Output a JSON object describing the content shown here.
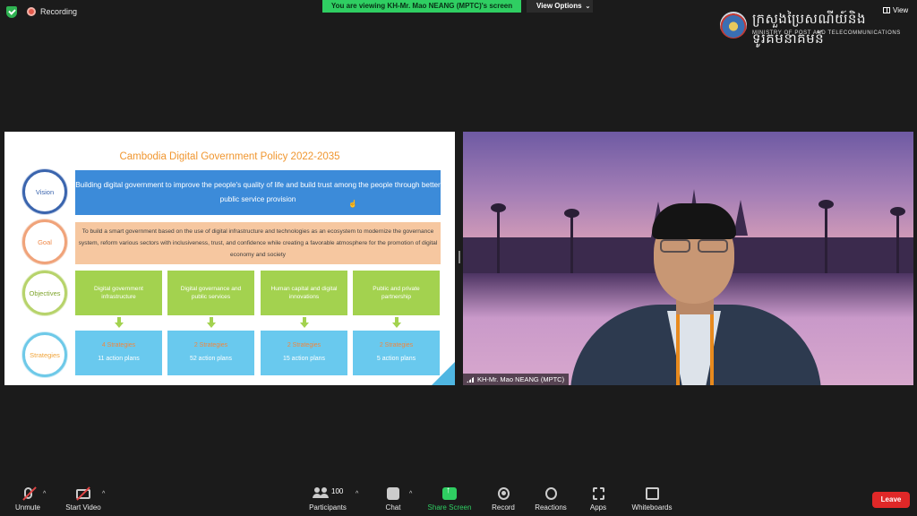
{
  "top_bar": {
    "recording_label": "Recording",
    "viewing_banner": "You are viewing KH-Mr. Mao NEANG (MPTC)'s screen",
    "view_options_label": "View Options",
    "view_label": "View",
    "logo_khmer": "ក្រសួងប្រៃសណីយ៍និងទូរគមនាគមន៍",
    "logo_english": "MINISTRY OF POST AND TELECOMMUNICATIONS"
  },
  "slide": {
    "title": "Cambodia Digital Government Policy 2022-2035",
    "labels": {
      "vision": "Vision",
      "goal": "Goal",
      "objectives": "Objectives",
      "strategies": "Strategies"
    },
    "vision_text": "Building digital government to improve the people's quality of life and build trust among the people through better public service provision",
    "goal_text": "To build a smart government based on the use of digital infrastructure and technologies as an ecosystem to modernize the governance system, reform various sectors with inclusiveness, trust, and confidence while creating a favorable atmosphere for the promotion of digital economy and society",
    "objectives": [
      "Digital government infrastructure",
      "Digital governance and public services",
      "Human capital and digital innovations",
      "Public and private partnership"
    ],
    "strategies": [
      {
        "count": "4 Strategies",
        "plans": "11 action plans"
      },
      {
        "count": "2 Strategies",
        "plans": "52 action plans"
      },
      {
        "count": "2 Strategies",
        "plans": "15 action plans"
      },
      {
        "count": "2 Strategies",
        "plans": "5 action plans"
      }
    ]
  },
  "video": {
    "participant_name": "KH-Mr. Mao NEANG (MPTC)"
  },
  "toolbar": {
    "unmute": "Unmute",
    "start_video": "Start Video",
    "participants": "Participants",
    "participant_count": "100",
    "chat": "Chat",
    "share_screen": "Share Screen",
    "record": "Record",
    "reactions": "Reactions",
    "apps": "Apps",
    "whiteboards": "Whiteboards",
    "leave": "Leave"
  },
  "colors": {
    "share_green": "#2fce62",
    "leave_red": "#e02828",
    "vision_blue": "#3c8bd9",
    "goal_peach": "#f6c7a0",
    "objective_green": "#a3d24f",
    "strategy_cyan": "#69c9ee",
    "title_orange": "#f0962f"
  }
}
